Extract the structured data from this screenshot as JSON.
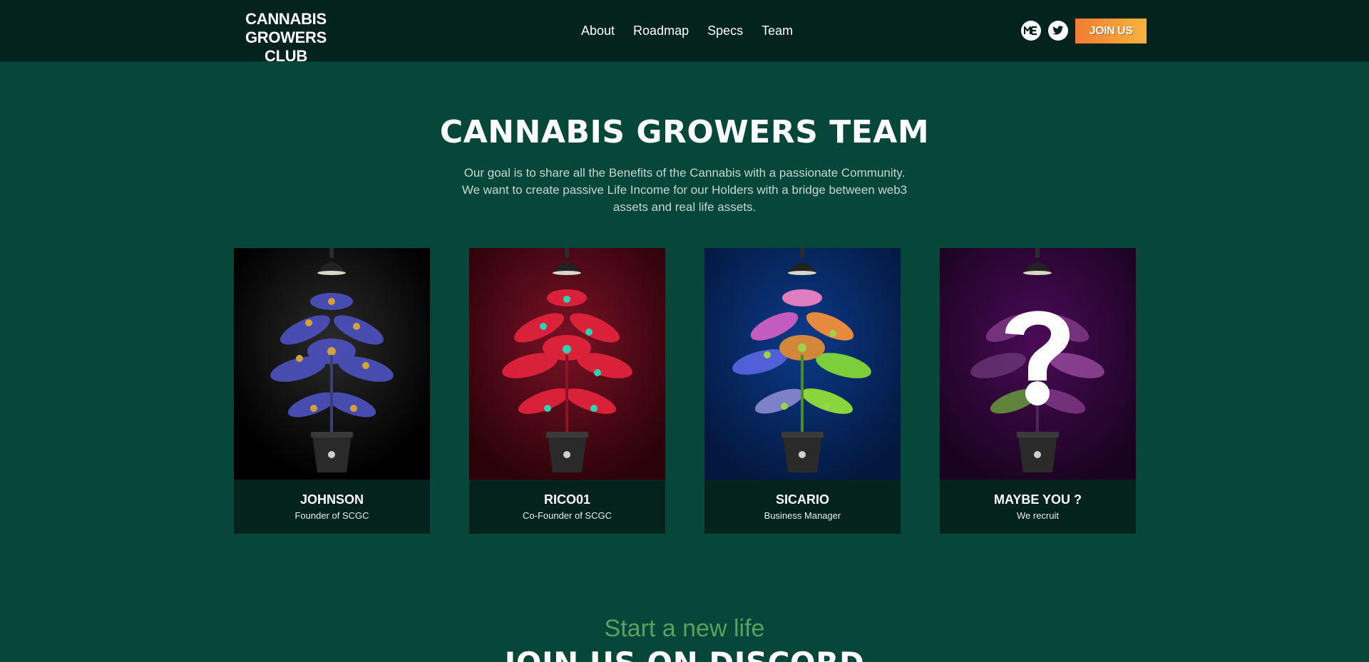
{
  "nav": {
    "brand_line1": "CANNABIS",
    "brand_line2": "GROWERS CLUB",
    "links": [
      "About",
      "Roadmap",
      "Specs",
      "Team"
    ],
    "social": [
      {
        "icon": "magic-eden-icon",
        "label": "ME"
      },
      {
        "icon": "twitter-icon"
      }
    ],
    "join_label": "JOIN US",
    "join_gradient": [
      "#f07c33",
      "#f7b43b"
    ]
  },
  "team": {
    "title": "CANNABIS GROWERS TEAM",
    "description": "Our goal is to share all the Benefits of the Cannabis with a passionate Community. We want to create passive Life Income for our Holders with a bridge between web3 assets and real life assets.",
    "members": [
      {
        "name": "JOHNSON",
        "role": "Founder of SCGC",
        "theme": "black",
        "leaf": "#4b4fb8",
        "bud": "#d1a33a"
      },
      {
        "name": "RICO01",
        "role": "Co-Founder of SCGC",
        "theme": "red",
        "leaf": "#e0233b",
        "bud": "#2fd1b5"
      },
      {
        "name": "SICARIO",
        "role": "Business Manager",
        "theme": "blue",
        "leaf": "#e58a3e",
        "bud": "#9bd34a"
      },
      {
        "name": "MAYBE YOU ?",
        "role": "We recruit",
        "theme": "purple",
        "leaf": "#8a3f8f",
        "bud": "#6fae3b"
      }
    ]
  },
  "cta": {
    "subtitle": "Start a new life",
    "title": "JOIN US ON DISCORD"
  },
  "colors": {
    "page_bg": "#07473a",
    "nav_bg": "#03231c",
    "card_footer_bg": "#03231c",
    "accent_green": "#5aa15f"
  }
}
